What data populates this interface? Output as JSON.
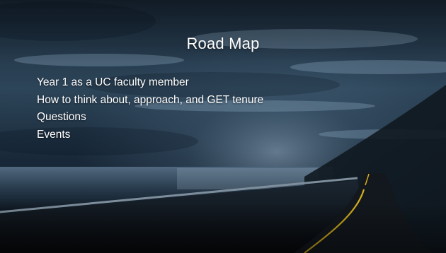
{
  "slide": {
    "title": "Road Map",
    "bullets": [
      "Year 1 as a UC faculty member",
      "How to think about, approach, and GET tenure",
      "Questions",
      "Events"
    ]
  },
  "colors": {
    "text": "#ffffff",
    "sky_light": "#5a7f9a",
    "sky_dark": "#0b1826",
    "road": "#14191f",
    "road_line": "#d6b01c"
  }
}
